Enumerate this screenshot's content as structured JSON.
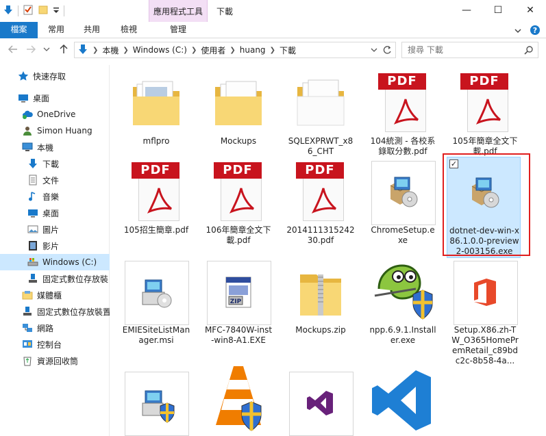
{
  "window": {
    "title": "下載",
    "contextual_tab_group": "應用程式工具",
    "controls": {
      "minimize": "—",
      "maximize": "☐",
      "close": "✕"
    }
  },
  "ribbon": {
    "tabs": [
      {
        "label": "檔案"
      },
      {
        "label": "常用"
      },
      {
        "label": "共用"
      },
      {
        "label": "檢視"
      },
      {
        "label": "管理"
      }
    ]
  },
  "address": {
    "crumbs": [
      "本機",
      "Windows (C:)",
      "使用者",
      "huang",
      "下載"
    ],
    "search_placeholder": "搜尋 下載"
  },
  "sidebar": {
    "items": [
      {
        "label": "快速存取",
        "icon": "star-icon"
      },
      {
        "label": "桌面",
        "icon": "desktop-icon"
      },
      {
        "label": "OneDrive",
        "icon": "cloud-icon"
      },
      {
        "label": "Simon Huang",
        "icon": "user-icon"
      },
      {
        "label": "本機",
        "icon": "computer-icon"
      },
      {
        "label": "下載",
        "icon": "download-icon"
      },
      {
        "label": "文件",
        "icon": "document-icon"
      },
      {
        "label": "音樂",
        "icon": "music-icon"
      },
      {
        "label": "桌面",
        "icon": "desktop-icon"
      },
      {
        "label": "圖片",
        "icon": "picture-icon"
      },
      {
        "label": "影片",
        "icon": "video-icon"
      },
      {
        "label": "Windows (C:)",
        "icon": "drive-icon"
      },
      {
        "label": "固定式數位存放裝",
        "icon": "media-device-icon"
      },
      {
        "label": "媒體櫃",
        "icon": "library-icon"
      },
      {
        "label": "固定式數位存放裝置",
        "icon": "media-device-icon"
      },
      {
        "label": "網路",
        "icon": "network-icon"
      },
      {
        "label": "控制台",
        "icon": "control-panel-icon"
      },
      {
        "label": "資源回收筒",
        "icon": "recycle-bin-icon"
      }
    ]
  },
  "files": [
    {
      "name": "mflpro",
      "type": "folder"
    },
    {
      "name": "Mockups",
      "type": "folder"
    },
    {
      "name": "SQLEXPRWT_x86_CHT",
      "type": "folder-white"
    },
    {
      "name": "104統測 - 各校系錄取分數.pdf",
      "type": "pdf",
      "badge": "PDF"
    },
    {
      "name": "105年簡章全文下載.pdf",
      "type": "pdf",
      "badge": "PDF"
    },
    {
      "name": "105招生簡章.pdf",
      "type": "pdf",
      "badge": "PDF"
    },
    {
      "name": "106年簡章全文下載.pdf",
      "type": "pdf",
      "badge": "PDF"
    },
    {
      "name": "2014111315242 30.pdf",
      "type": "pdf",
      "badge": "PDF"
    },
    {
      "name": "ChromeSetup.exe",
      "type": "installer"
    },
    {
      "name": "dotnet-dev-win-x86.1.0.0-preview2-003156.exe",
      "type": "installer",
      "selected": true
    },
    {
      "name": "EMIESiteListManager.msi",
      "type": "msi"
    },
    {
      "name": "MFC-7840W-inst-win8-A1.EXE",
      "type": "zip-exe"
    },
    {
      "name": "Mockups.zip",
      "type": "zip"
    },
    {
      "name": "npp.6.9.1.Installer.exe",
      "type": "npp"
    },
    {
      "name": "Setup.X86.zh-TW_O365HomePremRetail_c89bdc2c-8b58-4a...",
      "type": "office"
    },
    {
      "name": "",
      "type": "msi-shield"
    },
    {
      "name": "",
      "type": "vlc"
    },
    {
      "name": "",
      "type": "vs"
    },
    {
      "name": "",
      "type": "vscode"
    }
  ],
  "colors": {
    "file_tab": "#1979ca",
    "context_tab": "#f3dff5",
    "selection": "#cce8ff",
    "highlight_box": "#e01e1e",
    "pdf_red": "#c8141e"
  }
}
